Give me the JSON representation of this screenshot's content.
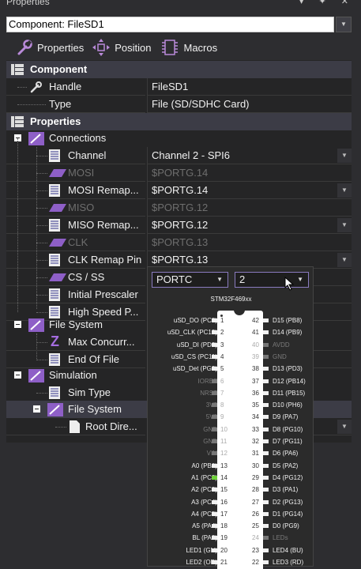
{
  "window": {
    "title": "Properties",
    "controls": "▾ ✦ ✕"
  },
  "component_select": {
    "value": "Component: FileSD1"
  },
  "toolbar": {
    "properties": "Properties",
    "position": "Position",
    "macros": "Macros"
  },
  "sections": {
    "component": "Component",
    "properties": "Properties",
    "connections": "Connections",
    "file_system": "File System",
    "simulation": "Simulation",
    "sim_file_system": "File System"
  },
  "rows": {
    "handle": {
      "label": "Handle",
      "value": "FileSD1"
    },
    "type": {
      "label": "Type",
      "value": "File (SD/SDHC Card)"
    },
    "channel": {
      "label": "Channel",
      "value": "Channel 2 - SPI6"
    },
    "mosi": {
      "label": "MOSI",
      "value": "$PORTG.14"
    },
    "mosi_remap": {
      "label": "MOSI Remap...",
      "value": "$PORTG.14"
    },
    "miso": {
      "label": "MISO",
      "value": "$PORTG.12"
    },
    "miso_remap": {
      "label": "MISO Remap...",
      "value": "$PORTG.12"
    },
    "clk": {
      "label": "CLK",
      "value": "$PORTG.13"
    },
    "clk_remap": {
      "label": "CLK Remap Pin",
      "value": "$PORTG.13"
    },
    "cs": {
      "label": "CS / SS"
    },
    "initial_prescaler": {
      "label": "Initial Prescaler"
    },
    "high_speed": {
      "label": "High Speed P..."
    },
    "max_concurrent": {
      "label": "Max Concurr..."
    },
    "end_of_file": {
      "label": "End Of File"
    },
    "sim_type": {
      "label": "Sim Type"
    },
    "root_dir": {
      "label": "Root Dire..."
    }
  },
  "popup": {
    "port_value": "PORTC",
    "pin_value": "2",
    "chip_name": "STM32F469xx",
    "left_pins": [
      {
        "label": "uSD_DO (PC8)",
        "num": "1",
        "dim": false
      },
      {
        "label": "uSD_CLK (PC12)",
        "num": "2",
        "dim": false
      },
      {
        "label": "uSD_DI (PD2)",
        "num": "3",
        "dim": false
      },
      {
        "label": "uSD_CS (PC11)",
        "num": "4",
        "dim": false
      },
      {
        "label": "uSD_Det (PG2)",
        "num": "5",
        "dim": false
      },
      {
        "label": "IOREF",
        "num": "6",
        "dim": true
      },
      {
        "label": "NRST",
        "num": "7",
        "dim": true
      },
      {
        "label": "3V3",
        "num": "8",
        "dim": true
      },
      {
        "label": "5V0",
        "num": "9",
        "dim": true
      },
      {
        "label": "GND",
        "num": "10",
        "dim": true
      },
      {
        "label": "GND",
        "num": "11",
        "dim": true
      },
      {
        "label": "VIN",
        "num": "12",
        "dim": true
      },
      {
        "label": "A0 (PB0)",
        "num": "13",
        "dim": false
      },
      {
        "label": "A1 (PC2)",
        "num": "14",
        "dim": false
      },
      {
        "label": "A2 (PC3)",
        "num": "15",
        "dim": false
      },
      {
        "label": "A3 (PC4)",
        "num": "16",
        "dim": false
      },
      {
        "label": "A4 (PC5)",
        "num": "17",
        "dim": false
      },
      {
        "label": "A5 (PA4)",
        "num": "18",
        "dim": false
      },
      {
        "label": "BL (PA3)",
        "num": "19",
        "dim": false
      },
      {
        "label": "LED1 (GN)",
        "num": "20",
        "dim": false
      },
      {
        "label": "LED2 (OR)",
        "num": "21",
        "dim": false
      }
    ],
    "right_pins": [
      {
        "label": "D15 (PB8)",
        "num": "42",
        "dim": false
      },
      {
        "label": "D14 (PB9)",
        "num": "41",
        "dim": false
      },
      {
        "label": "AVDD",
        "num": "40",
        "dim": true
      },
      {
        "label": "GND",
        "num": "39",
        "dim": true
      },
      {
        "label": "D13 (PD3)",
        "num": "38",
        "dim": false
      },
      {
        "label": "D12 (PB14)",
        "num": "37",
        "dim": false
      },
      {
        "label": "D11 (PB15)",
        "num": "36",
        "dim": false
      },
      {
        "label": "D10 (PH6)",
        "num": "35",
        "dim": false
      },
      {
        "label": "D9 (PA7)",
        "num": "34",
        "dim": false
      },
      {
        "label": "D8 (PG10)",
        "num": "33",
        "dim": false
      },
      {
        "label": "D7 (PG11)",
        "num": "32",
        "dim": false
      },
      {
        "label": "D6 (PA6)",
        "num": "31",
        "dim": false
      },
      {
        "label": "D5 (PA2)",
        "num": "30",
        "dim": false
      },
      {
        "label": "D4 (PG12)",
        "num": "29",
        "dim": false
      },
      {
        "label": "D3 (PA1)",
        "num": "28",
        "dim": false
      },
      {
        "label": "D2 (PG13)",
        "num": "27",
        "dim": false
      },
      {
        "label": "D1 (PG14)",
        "num": "26",
        "dim": false
      },
      {
        "label": "D0 (PG9)",
        "num": "25",
        "dim": false
      },
      {
        "label": "LEDs",
        "num": "24",
        "dim": true
      },
      {
        "label": "LED4 (BU)",
        "num": "23",
        "dim": false
      },
      {
        "label": "LED3 (RD)",
        "num": "22",
        "dim": false
      }
    ]
  },
  "colors": {
    "accent": "#8a7bbf",
    "category_bg": "#3c3c46",
    "active_pin": "#6fd13a"
  }
}
